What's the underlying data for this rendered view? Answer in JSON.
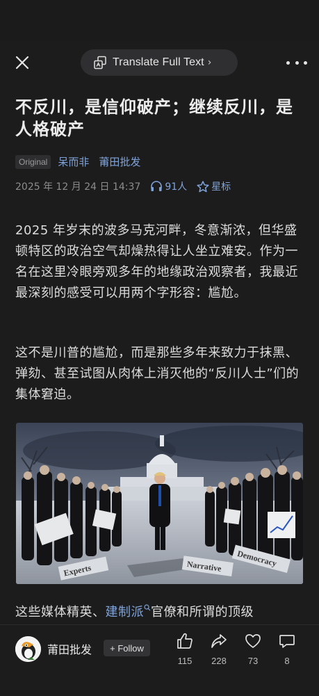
{
  "topbar": {
    "translate_label": "Translate Full Text",
    "translate_chevron": "›"
  },
  "article": {
    "title": "不反川，是信仰破产；继续反川，是人格破产",
    "badge": "Original",
    "authors": [
      "呆而非",
      "莆田批发"
    ],
    "date": "2025 年 12 月 24 日  14:37",
    "listeners": "91人",
    "star_label": "星标",
    "para1": "2025 年岁末的波多马克河畔，冬意渐浓，但华盛顿特区的政治空气却燥热得让人坐立难安。作为一名在这里冷眼旁观多年的地缘政治观察者，我最近最深刻的感受可以用两个字形容：尴尬。",
    "para2": "这不是川普的尴尬，而是那些多年来致力于抹黑、弹劾、甚至试图从肉体上消灭他的“反川人士”们的集体窘迫。",
    "para3_before": "这些媒体精英、",
    "para3_link": "建制派",
    "para3_after": "官僚和所谓的顶级",
    "image_words": [
      "Experts",
      "Narrative",
      "Democracy"
    ]
  },
  "bottombar": {
    "account_name": "莆田批发",
    "follow_label": "+ Follow",
    "likes": "115",
    "shares": "228",
    "favorites": "73",
    "comments": "8"
  },
  "colors": {
    "background": "#1c1c1d",
    "link": "#7fa3d9",
    "text": "#dcdcdc"
  },
  "icons": [
    "close-icon",
    "translate-icon",
    "more-icon",
    "headphones-icon",
    "star-icon",
    "thumbs-up-icon",
    "share-icon",
    "heart-icon",
    "comment-icon",
    "search-icon"
  ]
}
